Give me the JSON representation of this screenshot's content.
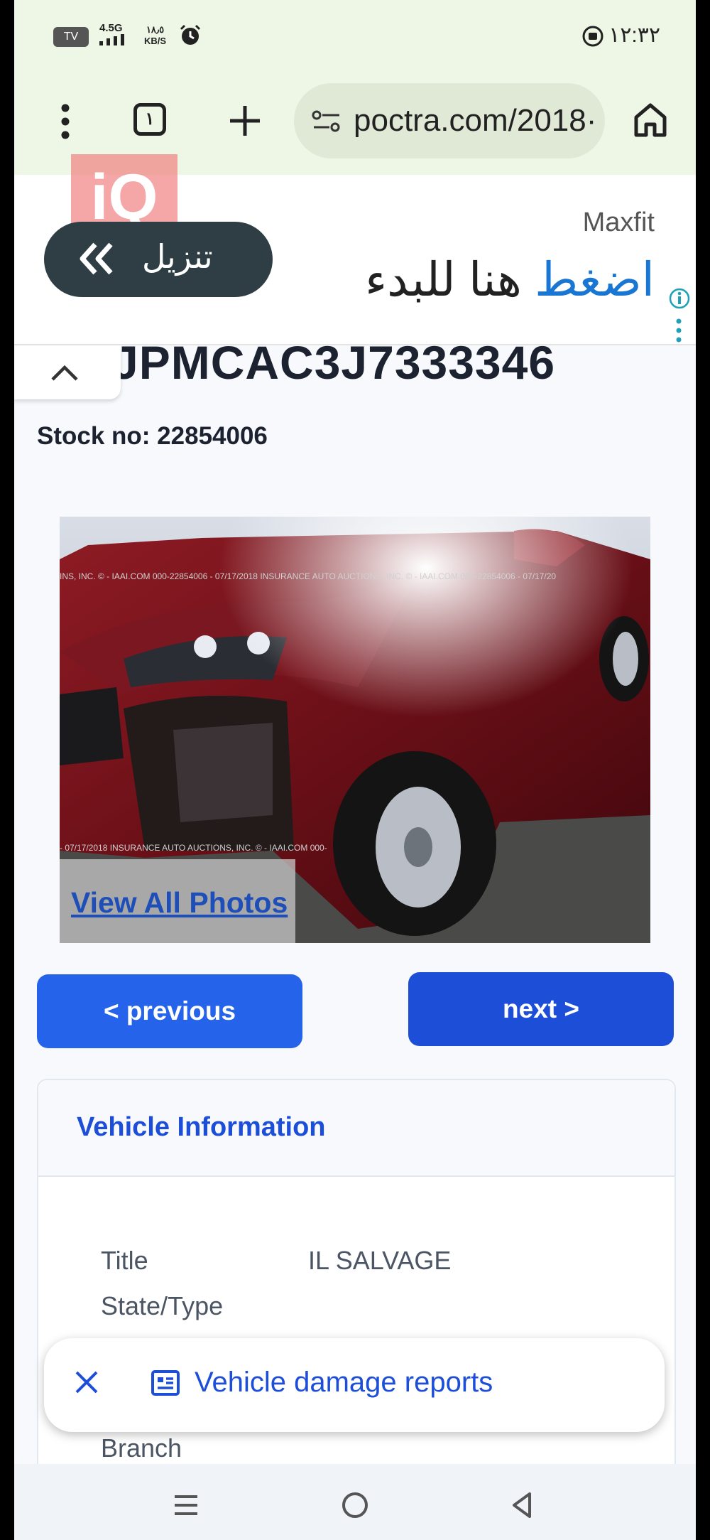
{
  "status_bar": {
    "tv_badge": "TV",
    "network": "4.5G",
    "speed_value": "١٨٫٥",
    "speed_unit": "KB/S",
    "time": "١٢:٣٢"
  },
  "browser": {
    "tab_count": "١",
    "url": "poctra.com/2018·"
  },
  "ad": {
    "logo_text": "iQ",
    "download_label": "تنزيل",
    "brand": "Maxfit",
    "headline_highlight": "اضغط",
    "headline_rest": " هنا للبدء"
  },
  "vehicle": {
    "vin_partial": "JPMCAC3J7333346",
    "stock": "Stock no: 22854006"
  },
  "photo": {
    "watermark_top": "INS, INC. © - IAAI.COM     000-22854006 - 07/17/2018 INSURANCE AUTO AUCTIONS, INC. © - IAAI.COM     000-22854006 - 07/17/20",
    "watermark_bottom": "- 07/17/2018 INSURANCE AUTO AUCTIONS, INC. © - IAAI.COM     000-",
    "view_all": "View All Photos"
  },
  "nav_buttons": {
    "previous": "< previous",
    "next": "next >"
  },
  "vehicle_info": {
    "title": "Vehicle Information",
    "rows": [
      {
        "label": "Title",
        "value": "IL SALVAGE"
      },
      {
        "label": "State/Type",
        "value": ""
      },
      {
        "label": "Branch",
        "value": ""
      }
    ]
  },
  "snackbar": {
    "text": "Vehicle damage reports"
  },
  "colors": {
    "accent": "#1d4ed8",
    "chrome_bg": "#eef7e6"
  }
}
